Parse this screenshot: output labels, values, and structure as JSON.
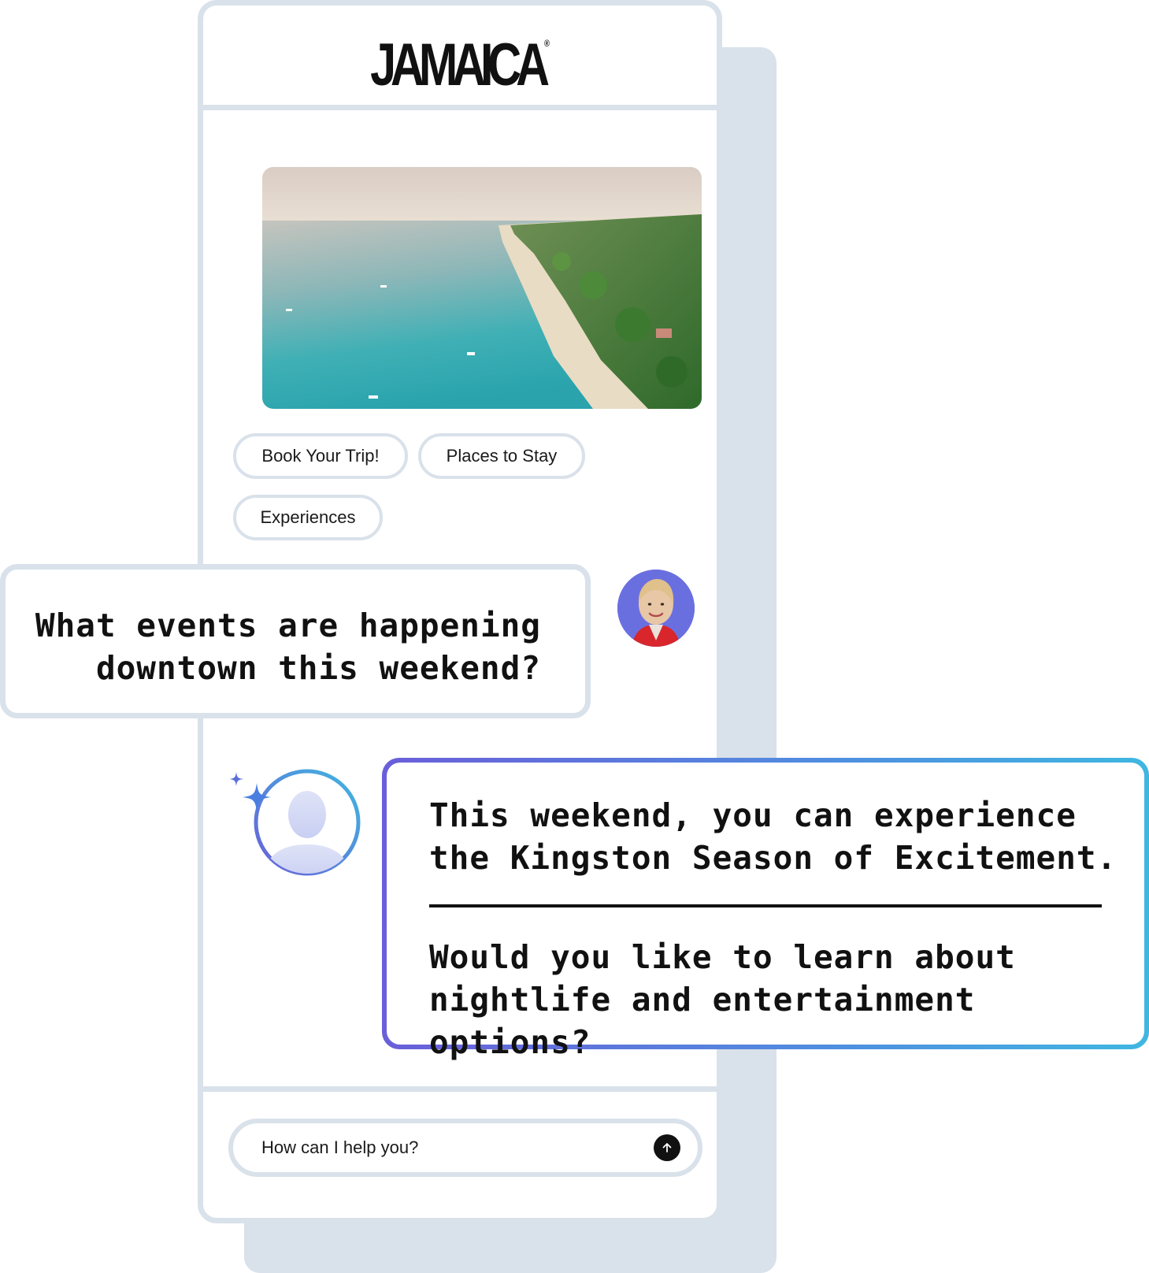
{
  "brand": {
    "logo_text": "JAMAICA",
    "logo_mark": "®"
  },
  "hero": {
    "image_subject": "aerial-beach-photo"
  },
  "quick_replies": [
    {
      "label": "Book Your Trip!"
    },
    {
      "label": "Places to Stay"
    },
    {
      "label": "Experiences"
    }
  ],
  "conversation": {
    "user_message": {
      "line1": "What events are happening",
      "line2": "downtown this weekend?"
    },
    "bot_message": {
      "line1": "This weekend, you can experience",
      "line2": "the Kingston Season of Excitement.",
      "line3": "Would you like to learn about",
      "line4": "nightlife and entertainment options?"
    }
  },
  "composer": {
    "placeholder": "How can I help you?",
    "send_icon": "arrow-up-icon"
  },
  "colors": {
    "frame": "#d9e1ea",
    "accent_start": "#6a5fd9",
    "accent_end": "#3fb7e0",
    "avatar_bg": "#6a6fe0",
    "text": "#111111"
  }
}
